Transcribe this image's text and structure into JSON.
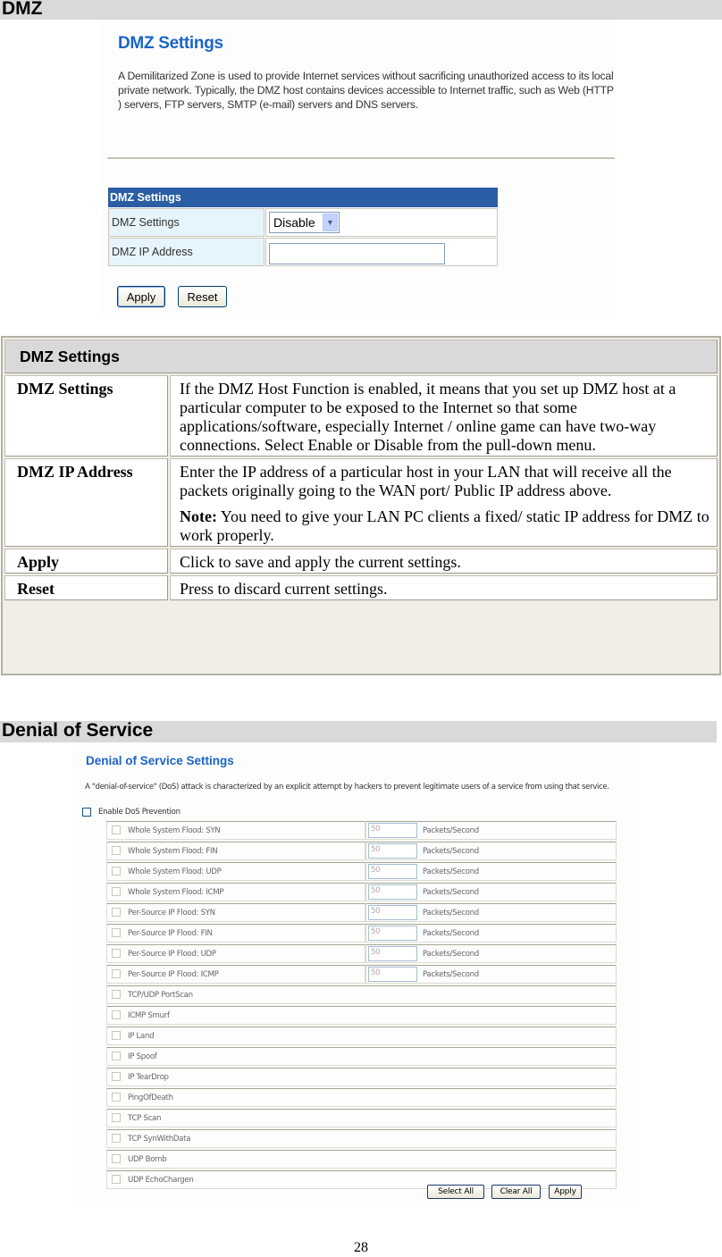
{
  "sections": {
    "dmz": "DMZ",
    "dos": "Denial of Service"
  },
  "dmz_screenshot": {
    "title": "DMZ Settings",
    "description": "A Demilitarized Zone is used to provide Internet services without sacrificing unauthorized access to its local private network. Typically, the DMZ host contains devices accessible to Internet traffic, such as Web (HTTP ) servers, FTP servers, SMTP (e-mail) servers and DNS servers.",
    "form_header": "DMZ Settings",
    "fields": {
      "settings_label": "DMZ Settings",
      "settings_value": "Disable",
      "ip_label": "DMZ IP Address",
      "ip_value": ""
    },
    "buttons": {
      "apply": "Apply",
      "reset": "Reset"
    }
  },
  "desc_table": {
    "header": "DMZ Settings",
    "rows": [
      {
        "term": "DMZ Settings",
        "definition": "If the DMZ Host Function is enabled, it means that you set up DMZ host at a particular computer to be exposed to the Internet so that some applications/software, especially Internet / online game can have two-way connections. Select Enable or Disable from the pull-down menu."
      },
      {
        "term": "DMZ IP Address",
        "definition": "Enter the IP address of a particular host in your LAN that will receive all the packets originally going to the WAN port/ Public IP address above.",
        "note_label": "Note:",
        "note_text": " You need to give your LAN PC clients a fixed/ static IP address for DMZ to work properly."
      },
      {
        "term": "Apply",
        "definition": "Click to save and apply the current settings."
      },
      {
        "term": "Reset",
        "definition": "Press to discard current settings."
      }
    ]
  },
  "dos_screenshot": {
    "title": "Denial of Service Settings",
    "description": "A \"denial-of-service\" (DoS) attack is characterized by an explicit attempt by hackers to prevent legitimate users of a service from using that service.",
    "enable_label": "Enable DoS Prevention",
    "enable_checked": false,
    "unit": "Packets/Second",
    "rate_items": [
      {
        "label": "Whole System Flood: SYN",
        "value": "50",
        "checked": false
      },
      {
        "label": "Whole System Flood: FIN",
        "value": "50",
        "checked": false
      },
      {
        "label": "Whole System Flood: UDP",
        "value": "50",
        "checked": false
      },
      {
        "label": "Whole System Flood: ICMP",
        "value": "50",
        "checked": false
      },
      {
        "label": "Per-Source IP Flood: SYN",
        "value": "50",
        "checked": false
      },
      {
        "label": "Per-Source IP Flood: FIN",
        "value": "50",
        "checked": false
      },
      {
        "label": "Per-Source IP Flood: UDP",
        "value": "50",
        "checked": false
      },
      {
        "label": "Per-Source IP Flood: ICMP",
        "value": "50",
        "checked": false
      }
    ],
    "simple_items": [
      {
        "label": "TCP/UDP PortScan",
        "checked": false
      },
      {
        "label": "ICMP Smurf",
        "checked": false
      },
      {
        "label": "IP Land",
        "checked": false
      },
      {
        "label": "IP Spoof",
        "checked": false
      },
      {
        "label": "IP TearDrop",
        "checked": false
      },
      {
        "label": "PingOfDeath",
        "checked": false
      },
      {
        "label": "TCP Scan",
        "checked": false
      },
      {
        "label": "TCP SynWithData",
        "checked": false
      },
      {
        "label": "UDP Bomb",
        "checked": false
      },
      {
        "label": "UDP EchoChargen",
        "checked": false
      }
    ],
    "buttons": {
      "select_all": "Select All",
      "clear_all": "Clear All",
      "apply": "Apply"
    }
  },
  "page_number": "28"
}
